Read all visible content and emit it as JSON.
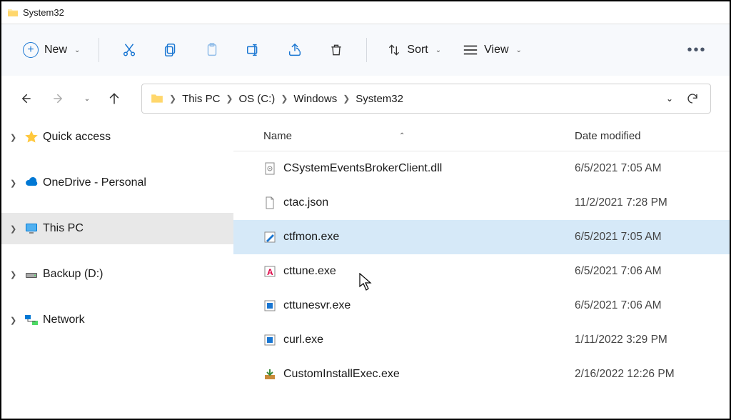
{
  "window": {
    "title": "System32"
  },
  "toolbar": {
    "new_label": "New",
    "sort_label": "Sort",
    "view_label": "View"
  },
  "breadcrumb": {
    "items": [
      "This PC",
      "OS (C:)",
      "Windows",
      "System32"
    ]
  },
  "sidebar": {
    "items": [
      {
        "label": "Quick access",
        "icon": "star"
      },
      {
        "label": "OneDrive - Personal",
        "icon": "cloud"
      },
      {
        "label": "This PC",
        "icon": "pc",
        "selected": true
      },
      {
        "label": "Backup (D:)",
        "icon": "drive"
      },
      {
        "label": "Network",
        "icon": "network"
      }
    ]
  },
  "columns": {
    "name": "Name",
    "date": "Date modified"
  },
  "files": [
    {
      "name": "CSystemEventsBrokerClient.dll",
      "date": "6/5/2021 7:05 AM",
      "icon": "dll"
    },
    {
      "name": "ctac.json",
      "date": "11/2/2021 7:28 PM",
      "icon": "file"
    },
    {
      "name": "ctfmon.exe",
      "date": "6/5/2021 7:05 AM",
      "icon": "pen",
      "selected": true
    },
    {
      "name": "cttune.exe",
      "date": "6/5/2021 7:06 AM",
      "icon": "a"
    },
    {
      "name": "cttunesvr.exe",
      "date": "6/5/2021 7:06 AM",
      "icon": "exe"
    },
    {
      "name": "curl.exe",
      "date": "1/11/2022 3:29 PM",
      "icon": "exe"
    },
    {
      "name": "CustomInstallExec.exe",
      "date": "2/16/2022 12:26 PM",
      "icon": "install"
    }
  ]
}
